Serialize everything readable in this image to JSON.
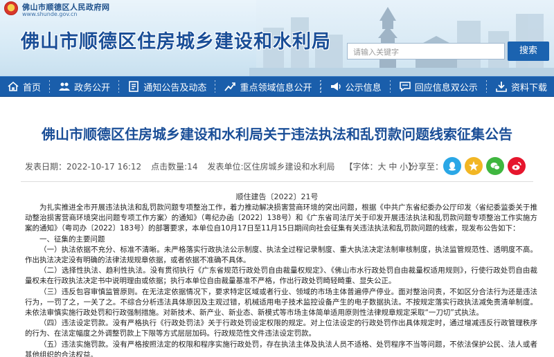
{
  "header": {
    "site_name": "佛山市顺德区人民政府网",
    "site_url": "www.shunde.gov.cn",
    "title": "佛山市顺德区住房城乡建设和水利局",
    "search_placeholder": "请输入关键字",
    "search_button": "搜索"
  },
  "nav": [
    {
      "label": "首页",
      "icon": "home-icon"
    },
    {
      "label": "政务公开",
      "icon": "people-icon"
    },
    {
      "label": "通知公告及动态",
      "icon": "document-icon"
    },
    {
      "label": "重点领域信息公开",
      "icon": "chart-icon"
    },
    {
      "label": "公示信息",
      "icon": "announce-icon"
    },
    {
      "label": "回应信息双公示",
      "icon": "chat-icon"
    },
    {
      "label": "资料下载",
      "icon": "download-icon"
    }
  ],
  "article": {
    "title": "佛山市顺德区住房城乡建设和水利局关于违法执法和乱罚款问题线索征集公告",
    "publish_time": "发表日期：2022-10-17 16:12",
    "views": "点击数量:14",
    "source": "发表单位:区住房城乡建设和水利局",
    "font_size": "【字体：大 中 小】",
    "share_label": "分享至：",
    "doc_no": "顺住建告〔2022〕21号",
    "paragraphs": [
      "为扎实推进全市开展违法执法和乱罚款问题专项整治工作，着力推动解决损害营商环境的突出问题，根据《中共广东省纪委办公厅印发〈省纪委监委关于推动整治损害营商环境突出问题专项工作方案〉的通知》（粤纪办函〔2022〕138号）和《广东省司法厅关于印发开展违法执法和乱罚款问题专项整治工作实施方案的通知》（粤司办〔2022〕183号）的部署要求，本单位自10月17日至11月15日期间向社会征集有关违法执法和乱罚款问题的线索，现发布公告如下：",
      "一、征集的主要问题",
      "（一）执法依据不充分、标准不清晰。未严格落实行政执法公示制度、执法全过程记录制度、重大执法决定法制审核制度，执法监管规范性、透明度不高。作出执法决定没有明确的法律法规规章依据，或者依据不准确不具体。",
      "（二）选择性执法、趋利性执法。没有贯彻执行《广东省规范行政处罚自由裁量权规定》、《佛山市水行政处罚自由裁量权适用规则》，行使行政处罚自由裁量权未在行政执法决定书中说明理由或依据；执行本单位自由裁量基准不严格，作出行政处罚畸轻畸重、显失公正。",
      "（三）违反包容审慎监管原则。在无法定依据情况下，要求特定区域或者行业、领域的市场主体普遍停产停业。面对整治问责，不如区分合法行为还是违法行为，一罚了之，一关了之。不综合分析违法具体原因及主观过错，机械适用电子技术监控设备产生的电子数据执法。不按规定落实行政执法减免责清单制度。未依法审慎实施行政处罚和行政强制措施。对新技术、新产业、新业态、新模式等市场主体简单适用原则性法律规章规定采取“一刀切”式执法。",
      "（四）违法设定罚款。没有严格执行《行政处罚法》关于行政处罚设定权限的规定。对上位法设定的行政处罚作出具体规定时，通过增减违反行政管理秩序的行为、在法定幅度之外调整罚款上下限等方式层层加码。行政规范性文件违法设定罚款。",
      "（五）违法实施罚款。没有严格按照法定的权限和程序实施行政处罚，存在执法主体及执法人员不适格、处罚程序不当等问题，不依法保护公民、法人或者其他组织的合法权益。"
    ]
  },
  "colors": {
    "brand_blue": "#1a5eab",
    "title_blue": "#1a4e97",
    "share_qq": "#2aa7e6",
    "share_qzone": "#f2b624",
    "share_wechat": "#3fb63f",
    "share_weibo": "#e6162d"
  }
}
